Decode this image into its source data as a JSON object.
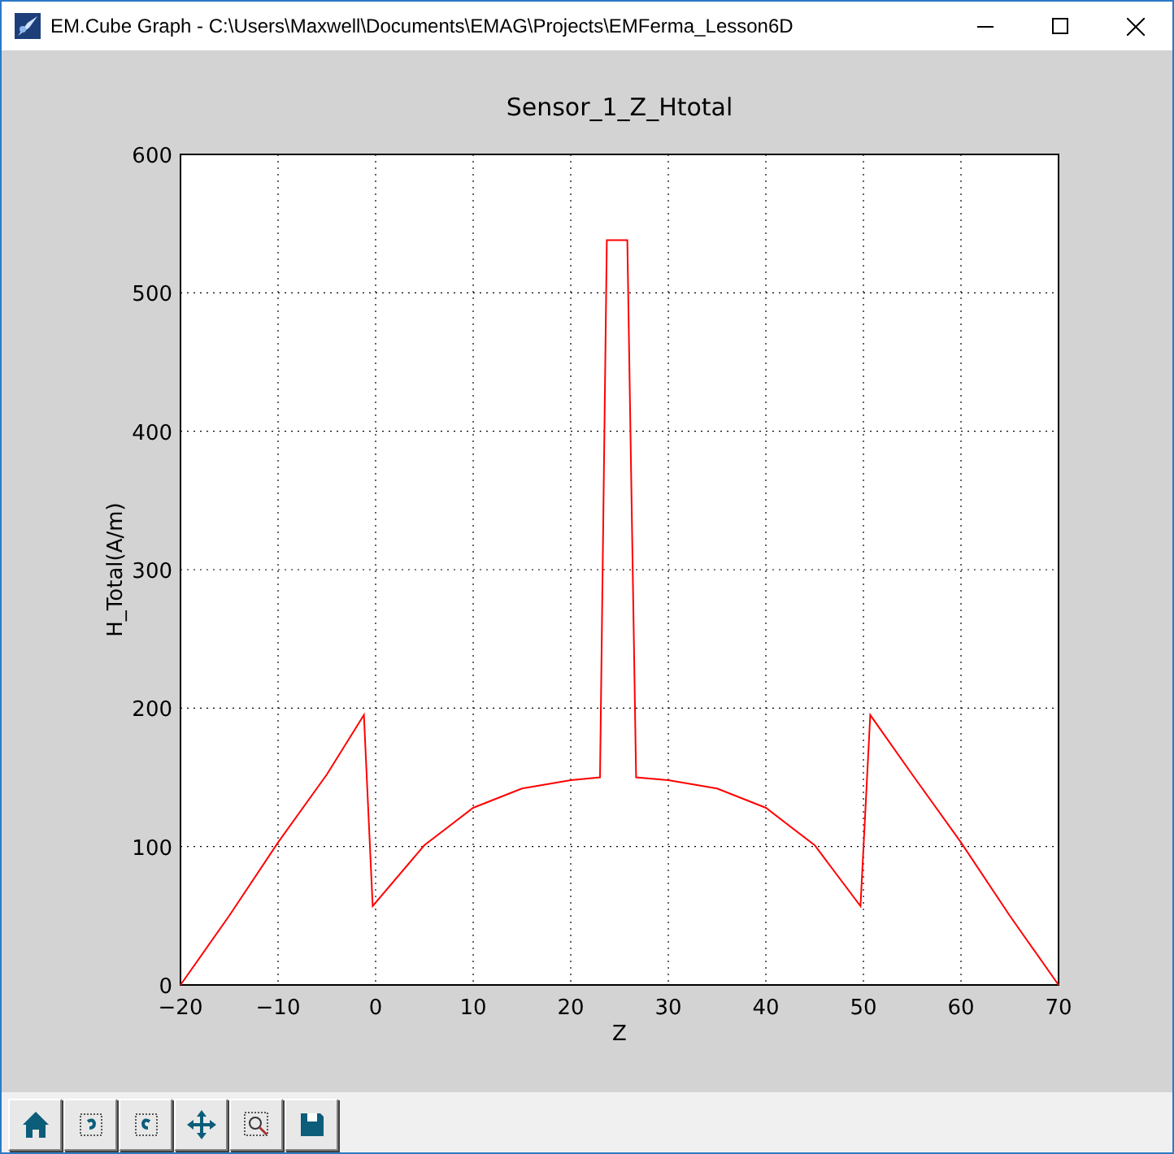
{
  "window": {
    "title": "EM.Cube Graph - C:\\Users\\Maxwell\\Documents\\EMAG\\Projects\\EMFerma_Lesson6D"
  },
  "chart": {
    "chart_data": {
      "type": "line",
      "title": "Sensor_1_Z_Htotal",
      "xlabel": "Z",
      "ylabel": "H_Total(A/m)",
      "x": [
        -20,
        -15,
        -10,
        -5,
        -1.2,
        -0.3,
        5,
        10,
        15,
        20,
        23,
        23.7,
        25.8,
        26.7,
        30,
        35,
        40,
        45,
        49.7,
        50.7,
        55,
        60,
        65,
        70
      ],
      "grid": true,
      "series": [
        {
          "color": "#ff0000",
          "values": [
            0,
            50,
            103,
            152,
            195,
            57,
            101,
            128,
            142,
            148,
            150,
            538,
            538,
            150,
            148,
            142,
            128,
            101,
            57,
            195,
            152,
            103,
            50,
            0
          ]
        }
      ],
      "xlim": [
        -20,
        70
      ],
      "ylim": [
        0,
        600
      ],
      "xticks": [
        {
          "value": -20,
          "label": "−20"
        },
        {
          "value": -10,
          "label": "−10"
        },
        0,
        10,
        20,
        30,
        40,
        50,
        60,
        70
      ],
      "yticks": [
        0,
        100,
        200,
        300,
        400,
        500,
        600
      ]
    }
  },
  "toolbar": [
    {
      "kind": "home"
    },
    {
      "kind": "back"
    },
    {
      "kind": "forward"
    },
    {
      "kind": "pan"
    },
    {
      "kind": "zoom"
    },
    {
      "kind": "save"
    }
  ]
}
